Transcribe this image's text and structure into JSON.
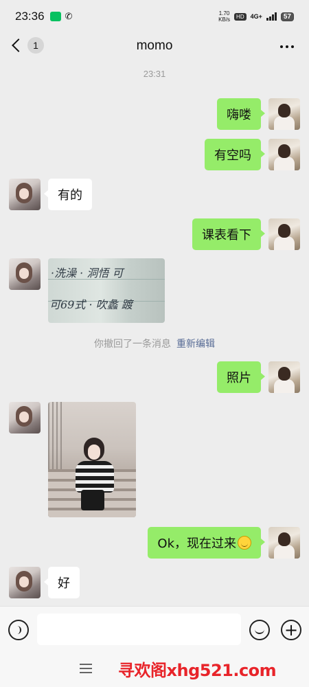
{
  "status_bar": {
    "time": "23:36",
    "net_speed": "1.70",
    "net_speed_unit": "KB/s",
    "hd_label": "HD",
    "network": "4G+",
    "battery": "57"
  },
  "header": {
    "title": "momo",
    "unread_count": "1"
  },
  "chat": {
    "timestamp": "23:31",
    "messages": [
      {
        "from": "me",
        "text": "嗨喽"
      },
      {
        "from": "me",
        "text": "有空吗"
      },
      {
        "from": "her",
        "text": "有的"
      },
      {
        "from": "me",
        "text": "课表看下"
      },
      {
        "from": "her",
        "type": "image",
        "image_text_line1": "·洗澡 · 洞悟  可",
        "image_text_line2": "可69式 · 吹蠡  踱"
      },
      {
        "from": "me",
        "text": "照片"
      },
      {
        "from": "her",
        "type": "image"
      },
      {
        "from": "me",
        "text": "Ok，现在过来"
      },
      {
        "from": "her",
        "text": "好"
      }
    ],
    "recall_notice": "你撤回了一条消息",
    "reedit_label": "重新编辑"
  },
  "input": {
    "placeholder": ""
  },
  "footer": {
    "watermark": "寻欢阁xhg521.com"
  }
}
